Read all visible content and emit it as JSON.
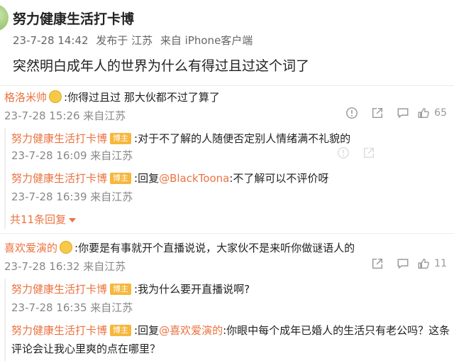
{
  "post": {
    "author": "努力健康生活打卡博",
    "date": "23-7-28 14:42",
    "published_from": "发布于 江苏",
    "device": "来自 iPhone客户端",
    "text": "突然明白成年人的世界为什么有得过且过这个词了"
  },
  "badge_label": "博主",
  "comments": [
    {
      "name": "格洛米帅",
      "text": ":你得过且过 那大伙都不过了算了",
      "time": "23-7-28 15:26 来自江苏",
      "likes": "65",
      "replies": [
        {
          "name": "努力健康生活打卡博",
          "text": ":对于不了解的人随便否定别人情绪满不礼貌的",
          "time": "23-7-28 16:09 来自江苏"
        },
        {
          "name": "努力健康生活打卡博",
          "prefix": ":回复",
          "mention": "@BlackToona",
          "text": ":不了解可以不评价呀",
          "time": "23-7-28 16:39 来自江苏"
        }
      ],
      "more_label": "共11条回复"
    },
    {
      "name": "喜欢爱演的",
      "text": ":你要是有事就开个直播说说，大家伙不是来听你做谜语人的",
      "time": "23-7-28 16:32 来自江苏",
      "likes": "11",
      "replies": [
        {
          "name": "努力健康生活打卡博",
          "text": ":我为什么要开直播说啊?",
          "time": "23-7-28 16:35 来自江苏"
        },
        {
          "name": "努力健康生活打卡博",
          "prefix": ":回复",
          "mention": "@喜欢爱演的",
          "text": ":你眼中每个成年已婚人的生活只有老公吗？这条",
          "text2": "评论会让我心里爽的点在哪里？"
        }
      ]
    }
  ],
  "icons": [
    "warning-icon",
    "share-icon",
    "comment-icon",
    "like-icon",
    "badge-emoji-icon"
  ],
  "colors": {
    "name": "#eb7340",
    "badge": "#f6b73c",
    "muted": "#888888"
  }
}
